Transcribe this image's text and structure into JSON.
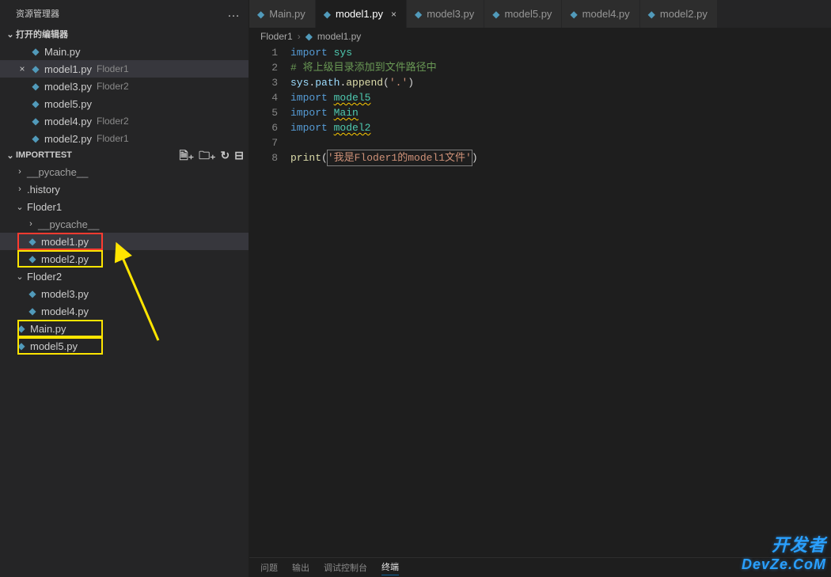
{
  "explorer": {
    "title": "资源管理器",
    "ellipsis": "…",
    "openEditors": {
      "label": "打开的编辑器",
      "items": [
        {
          "file": "Main.py",
          "dir": "",
          "close": ""
        },
        {
          "file": "model1.py",
          "dir": "Floder1",
          "close": "×",
          "active": true
        },
        {
          "file": "model3.py",
          "dir": "Floder2",
          "close": ""
        },
        {
          "file": "model5.py",
          "dir": "",
          "close": ""
        },
        {
          "file": "model4.py",
          "dir": "Floder2",
          "close": ""
        },
        {
          "file": "model2.py",
          "dir": "Floder1",
          "close": ""
        }
      ]
    },
    "workspace": {
      "label": "IMPORTTEST",
      "actions": {
        "newFile": "🗎₊",
        "newFolder": "🗀₊",
        "refresh": "↻",
        "collapse": "⊟"
      },
      "tree": [
        {
          "kind": "folder",
          "name": "__pycache__",
          "depth": 0,
          "open": false
        },
        {
          "kind": "folder",
          "name": ".history",
          "depth": 0,
          "open": false
        },
        {
          "kind": "folder",
          "name": "Floder1",
          "depth": 0,
          "open": true
        },
        {
          "kind": "folder",
          "name": "__pycache__",
          "depth": 1,
          "open": false
        },
        {
          "kind": "file",
          "name": "model1.py",
          "depth": 1,
          "selected": true,
          "box": "red"
        },
        {
          "kind": "file",
          "name": "model2.py",
          "depth": 1,
          "box": "yellow"
        },
        {
          "kind": "folder",
          "name": "Floder2",
          "depth": 0,
          "open": true
        },
        {
          "kind": "file",
          "name": "model3.py",
          "depth": 1
        },
        {
          "kind": "file",
          "name": "model4.py",
          "depth": 1
        },
        {
          "kind": "file",
          "name": "Main.py",
          "depth": 0,
          "box": "yellow"
        },
        {
          "kind": "file",
          "name": "model5.py",
          "depth": 0,
          "box": "yellow"
        }
      ]
    }
  },
  "tabs": [
    {
      "label": "Main.py",
      "active": false
    },
    {
      "label": "model1.py",
      "active": true
    },
    {
      "label": "model3.py",
      "active": false
    },
    {
      "label": "model5.py",
      "active": false
    },
    {
      "label": "model4.py",
      "active": false
    },
    {
      "label": "model2.py",
      "active": false
    }
  ],
  "breadcrumb": {
    "folder": "Floder1",
    "file": "model1.py"
  },
  "code": {
    "lines": [
      {
        "n": 1,
        "html": "<span class='tok-kw'>import</span> <span class='tok-mod'>sys</span>"
      },
      {
        "n": 2,
        "html": "<span class='tok-cmt'># 将上级目录添加到文件路径中</span>"
      },
      {
        "n": 3,
        "html": "<span class='tok-obj'>sys</span><span class='tok-pun'>.</span><span class='tok-obj'>path</span><span class='tok-pun'>.</span><span class='tok-fn'>append</span><span class='tok-pun'>(</span><span class='tok-str'>'.'</span><span class='tok-pun'>)</span>"
      },
      {
        "n": 4,
        "html": "<span class='tok-kw'>import</span> <span class='tok-mod wavy'>model5</span>"
      },
      {
        "n": 5,
        "html": "<span class='tok-kw'>import</span> <span class='tok-mod wavy'>Main</span>"
      },
      {
        "n": 6,
        "html": "<span class='tok-kw'>import</span> <span class='tok-mod wavy'>model2</span>"
      },
      {
        "n": 7,
        "html": ""
      },
      {
        "n": 8,
        "html": "<span class='tok-fn'>print</span><span class='tok-pun'>(</span><span class='cursor-box'><span class='tok-str'>'我是Floder1的model1文件'</span></span><span class='tok-pun'>)</span>"
      }
    ]
  },
  "panel": {
    "tabs": [
      "问题",
      "输出",
      "调试控制台",
      "终端"
    ],
    "activeIndex": 3
  },
  "watermark": {
    "line1": "开发者",
    "line2": "DevZe.CoM"
  },
  "icons": {
    "python": "◆",
    "chevRight": "›",
    "chevDown": "⌄"
  }
}
